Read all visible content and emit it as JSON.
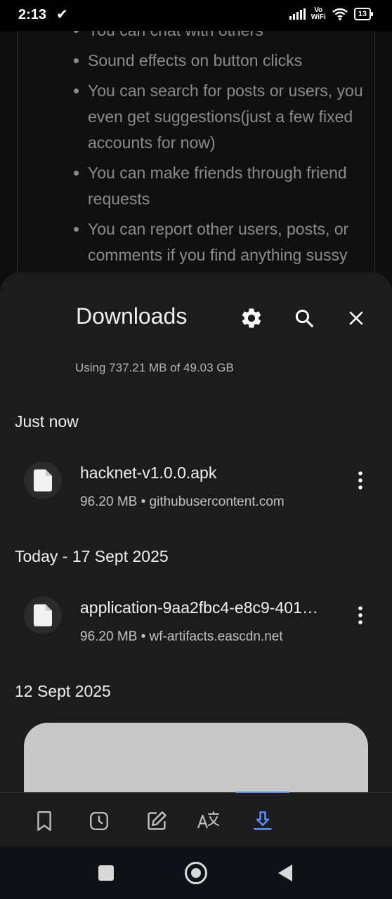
{
  "status_bar": {
    "time": "2:13",
    "vowifi_top": "Vo",
    "vowifi_bottom": "WiFi",
    "battery": "13"
  },
  "background_page": {
    "features": [
      "You can chat with others",
      "Sound effects on button clicks",
      "You can search for posts or users, you even get suggestions(just a few fixed accounts for now)",
      "You can make friends through friend requests",
      "You can report other users, posts, or comments if you find anything sussy"
    ]
  },
  "downloads": {
    "title": "Downloads",
    "storage_text": "Using 737.21 MB of 49.03 GB",
    "sections": [
      {
        "label": "Just now",
        "item": {
          "name": "hacknet-v1.0.0.apk",
          "meta": "96.20 MB • githubusercontent.com"
        }
      },
      {
        "label": "Today - 17 Sept 2025",
        "item": {
          "name": "application-9aa2fbc4-e8c9-401…",
          "meta": "96.20 MB • wf-artifacts.eascdn.net"
        }
      },
      {
        "label": "12 Sept 2025"
      }
    ]
  },
  "toolbar": {
    "items": [
      "bookmark-icon",
      "history-icon",
      "edit-note-icon",
      "translate-icon",
      "download-icon"
    ],
    "active": "download-icon",
    "accent_color": "#5a8cff"
  },
  "navigation": {
    "items": [
      "recents-button",
      "home-button",
      "back-button"
    ]
  }
}
